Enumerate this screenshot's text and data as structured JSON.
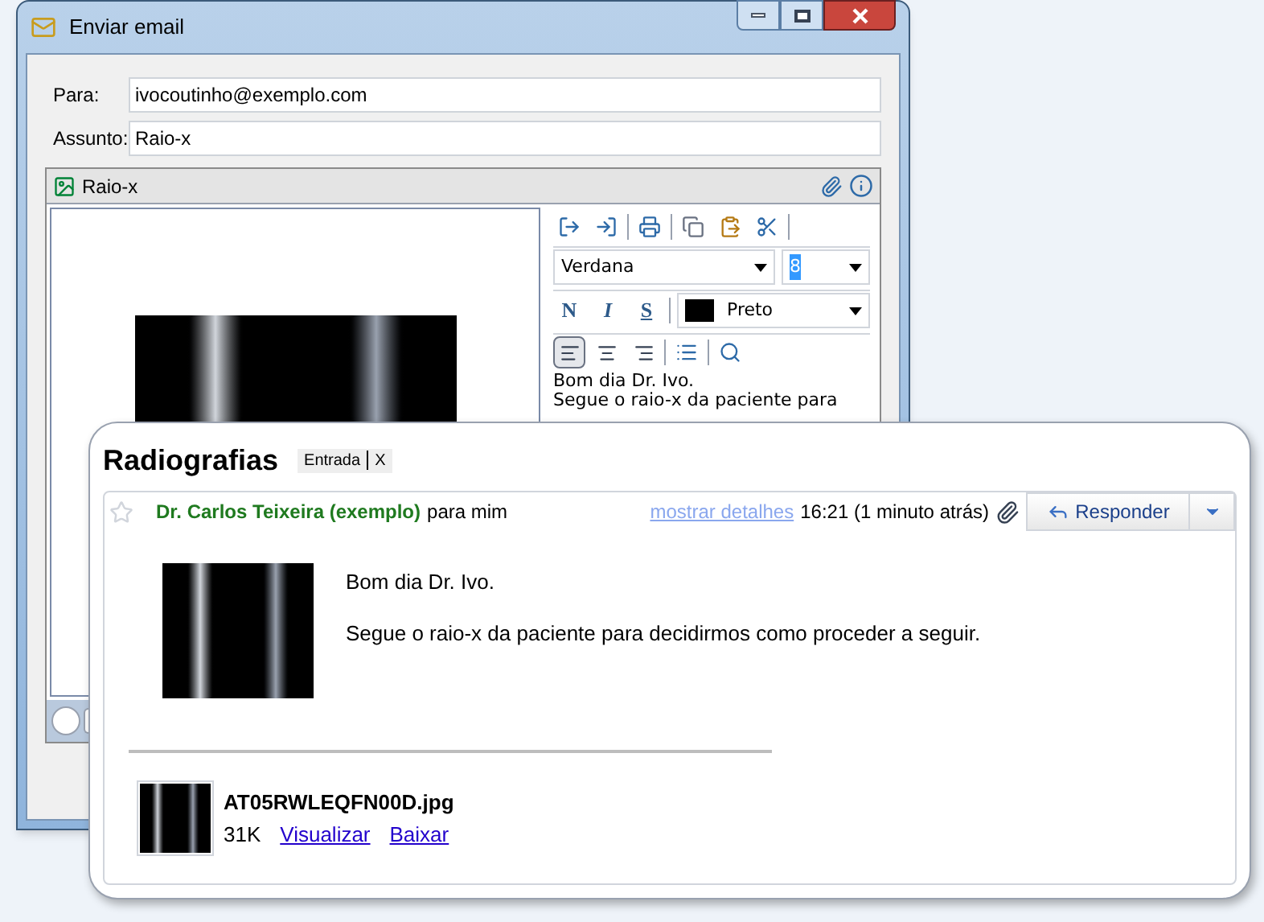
{
  "window": {
    "title": "Enviar email"
  },
  "fields": [
    {
      "label": "Para:",
      "value": "ivocoutinho@exemplo.com"
    },
    {
      "label": "Assunto:",
      "value": "Raio-x"
    }
  ],
  "attachment_panel": {
    "title": "Raio-x"
  },
  "editor": {
    "font": "Verdana",
    "size": "8",
    "format_buttons": [
      "N",
      "I",
      "S"
    ],
    "color_name": "Preto",
    "alignment": [
      {
        "selected": true
      },
      {
        "selected": false
      },
      {
        "selected": false
      }
    ],
    "body": [
      "Bom dia Dr. Ivo.",
      "Segue o raio-x da paciente para"
    ]
  },
  "message": {
    "subject": "Radiografias",
    "label": "Entrada",
    "label_remove": "X",
    "starred": false,
    "sender": "Dr. Carlos Teixeira (exemplo)",
    "recipient": "para mim",
    "details_link": "mostrar detalhes",
    "time": "16:21 (1 minuto atrás)",
    "reply_button": "Responder",
    "body": [
      "Bom dia Dr. Ivo.",
      "Segue o raio-x da paciente para decidirmos como proceder a seguir."
    ],
    "attachment": {
      "filename": "AT05RWLEQFN00D.jpg",
      "size": "31K",
      "links": [
        "Visualizar",
        "Baixar"
      ]
    }
  }
}
